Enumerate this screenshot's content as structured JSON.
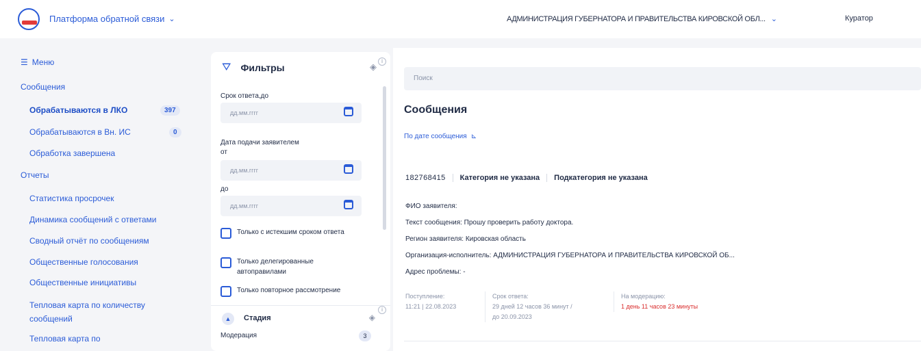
{
  "header": {
    "platform": "Платформа обратной связи",
    "org": "АДМИНИСТРАЦИЯ ГУБЕРНАТОРА И ПРАВИТЕЛЬСТВА КИРОВСКОЙ ОБЛ...",
    "role": "Куратор"
  },
  "sidebar": {
    "menu": "Меню",
    "messages_section": "Сообщения",
    "messages": [
      {
        "label": "Обрабатываются в ЛКО",
        "count": "397"
      },
      {
        "label": "Обрабатываются в Вн. ИС",
        "count": "0"
      },
      {
        "label": "Обработка завершена"
      }
    ],
    "reports_section": "Отчеты",
    "reports": [
      "Статистика просрочек",
      "Динамика сообщений с ответами",
      "Сводный отчёт по сообщениям",
      "Общественные голосования",
      "Общественные инициативы",
      "Тепловая карта по количеству сообщений",
      "Тепловая карта по"
    ]
  },
  "filters": {
    "title": "Фильтры",
    "due_label": "Срок ответа,до",
    "date_placeholder": "дд.мм.гггг",
    "submit_label": "Дата подачи заявителем",
    "from_label": "от",
    "to_label": "до",
    "checkboxes": [
      "Только с истекшим сроком ответа",
      "Только делегированные автоправилами",
      "Только повторное рассмотрение"
    ],
    "stage_title": "Стадия",
    "stage_item": "Модерация",
    "stage_count": "3"
  },
  "main": {
    "search_placeholder": "Поиск",
    "title": "Сообщения",
    "sort_label": "По дате сообщения",
    "card": {
      "id": "182768415",
      "category": "Категория не указана",
      "subcategory": "Подкатегория не указана",
      "applicant": "ФИО заявителя:",
      "text": "Текст сообщения: Прошу проверить работу доктора.",
      "region": "Регион заявителя: Кировская область",
      "executor": "Организация-исполнитель: АДМИНИСТРАЦИЯ ГУБЕРНАТОРА И ПРАВИТЕЛЬСТВА КИРОВСКОЙ ОБ...",
      "address": "Адрес проблемы: -",
      "received_label": "Поступление:",
      "received_value": "11:21 | 22.08.2023",
      "due_label": "Срок ответа:",
      "due_value1": "29 дней 12 часов 36 минут /",
      "due_value2": "до 20.09.2023",
      "moderation_label": "На модерацию:",
      "moderation_value": "1 день 11 часов 23 минуты"
    }
  },
  "colors": {
    "accent": "#2a5bd7",
    "danger": "#d92d2d",
    "background": "#f4f5f8"
  }
}
